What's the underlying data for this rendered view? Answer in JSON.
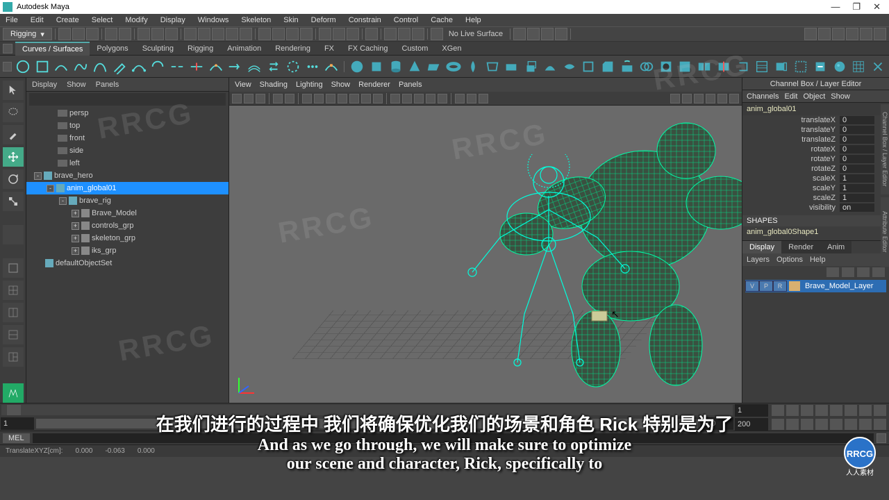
{
  "titlebar": {
    "title": "Autodesk Maya"
  },
  "window_buttons": {
    "min": "—",
    "max": "❐",
    "close": "✕"
  },
  "menubar": [
    "File",
    "Edit",
    "Create",
    "Select",
    "Modify",
    "Display",
    "Windows",
    "Skeleton",
    "Skin",
    "Deform",
    "Constrain",
    "Control",
    "Cache",
    "Help"
  ],
  "mode_dropdown": "Rigging",
  "no_live_surface": "No Live Surface",
  "shelf_tabs": [
    "Curves / Surfaces",
    "Polygons",
    "Sculpting",
    "Rigging",
    "Animation",
    "Rendering",
    "FX",
    "FX Caching",
    "Custom",
    "XGen"
  ],
  "outliner": {
    "menus": [
      "Display",
      "Show",
      "Panels"
    ],
    "items": [
      {
        "label": "persp",
        "indent": 1,
        "type": "cam"
      },
      {
        "label": "top",
        "indent": 1,
        "type": "cam"
      },
      {
        "label": "front",
        "indent": 1,
        "type": "cam"
      },
      {
        "label": "side",
        "indent": 1,
        "type": "cam"
      },
      {
        "label": "left",
        "indent": 1,
        "type": "cam"
      },
      {
        "label": "brave_hero",
        "indent": 0,
        "type": "node",
        "exp": "-"
      },
      {
        "label": "anim_global01",
        "indent": 1,
        "type": "node",
        "exp": "-",
        "selected": true
      },
      {
        "label": "brave_rig",
        "indent": 2,
        "type": "node",
        "exp": "-"
      },
      {
        "label": "Brave_Model",
        "indent": 3,
        "type": "cube",
        "exp": "+"
      },
      {
        "label": "controls_grp",
        "indent": 3,
        "type": "cube",
        "exp": "+"
      },
      {
        "label": "skeleton_grp",
        "indent": 3,
        "type": "cube",
        "exp": "+"
      },
      {
        "label": "iks_grp",
        "indent": 3,
        "type": "cube",
        "exp": "+"
      },
      {
        "label": "defaultObjectSet",
        "indent": 0,
        "type": "set"
      }
    ]
  },
  "viewport": {
    "menus": [
      "View",
      "Shading",
      "Lighting",
      "Show",
      "Renderer",
      "Panels"
    ]
  },
  "channelbox": {
    "title": "Channel Box / Layer Editor",
    "tabs": [
      "Channels",
      "Edit",
      "Object",
      "Show"
    ],
    "object": "anim_global01",
    "attrs": [
      {
        "lbl": "translateX",
        "val": "0"
      },
      {
        "lbl": "translateY",
        "val": "0"
      },
      {
        "lbl": "translateZ",
        "val": "0"
      },
      {
        "lbl": "rotateX",
        "val": "0"
      },
      {
        "lbl": "rotateY",
        "val": "0"
      },
      {
        "lbl": "rotateZ",
        "val": "0"
      },
      {
        "lbl": "scaleX",
        "val": "1"
      },
      {
        "lbl": "scaleY",
        "val": "1"
      },
      {
        "lbl": "scaleZ",
        "val": "1"
      },
      {
        "lbl": "visibility",
        "val": "on"
      }
    ],
    "shapes_hdr": "SHAPES",
    "shape_name": "anim_global0Shape1"
  },
  "layers": {
    "tabs": [
      "Display",
      "Render",
      "Anim"
    ],
    "menu": [
      "Layers",
      "Options",
      "Help"
    ],
    "rows": [
      {
        "v": "V",
        "p": "P",
        "r": "R",
        "name": "Brave_Model_Layer"
      }
    ]
  },
  "sidetabs": [
    "Channel Box / Layer Editor",
    "Attribute Editor"
  ],
  "timeline": {
    "start": "1",
    "end": "200",
    "r1": "1",
    "r2": "200"
  },
  "cmdline": {
    "label": "MEL"
  },
  "statusbar": {
    "label": "TranslateXYZ[cm]:",
    "v1": "0.000",
    "v2": "-0.063",
    "v3": "0.000"
  },
  "subtitle": {
    "cn": "在我们进行的过程中 我们将确保优化我们的场景和角色 Rick 特别是为了",
    "en1": "And as we go through, we will make sure to optimize",
    "en2": "our scene and character, Rick, specifically to"
  },
  "watermark": "RRCG",
  "logo_text": "RRCG",
  "logo_sub": "人人素材"
}
